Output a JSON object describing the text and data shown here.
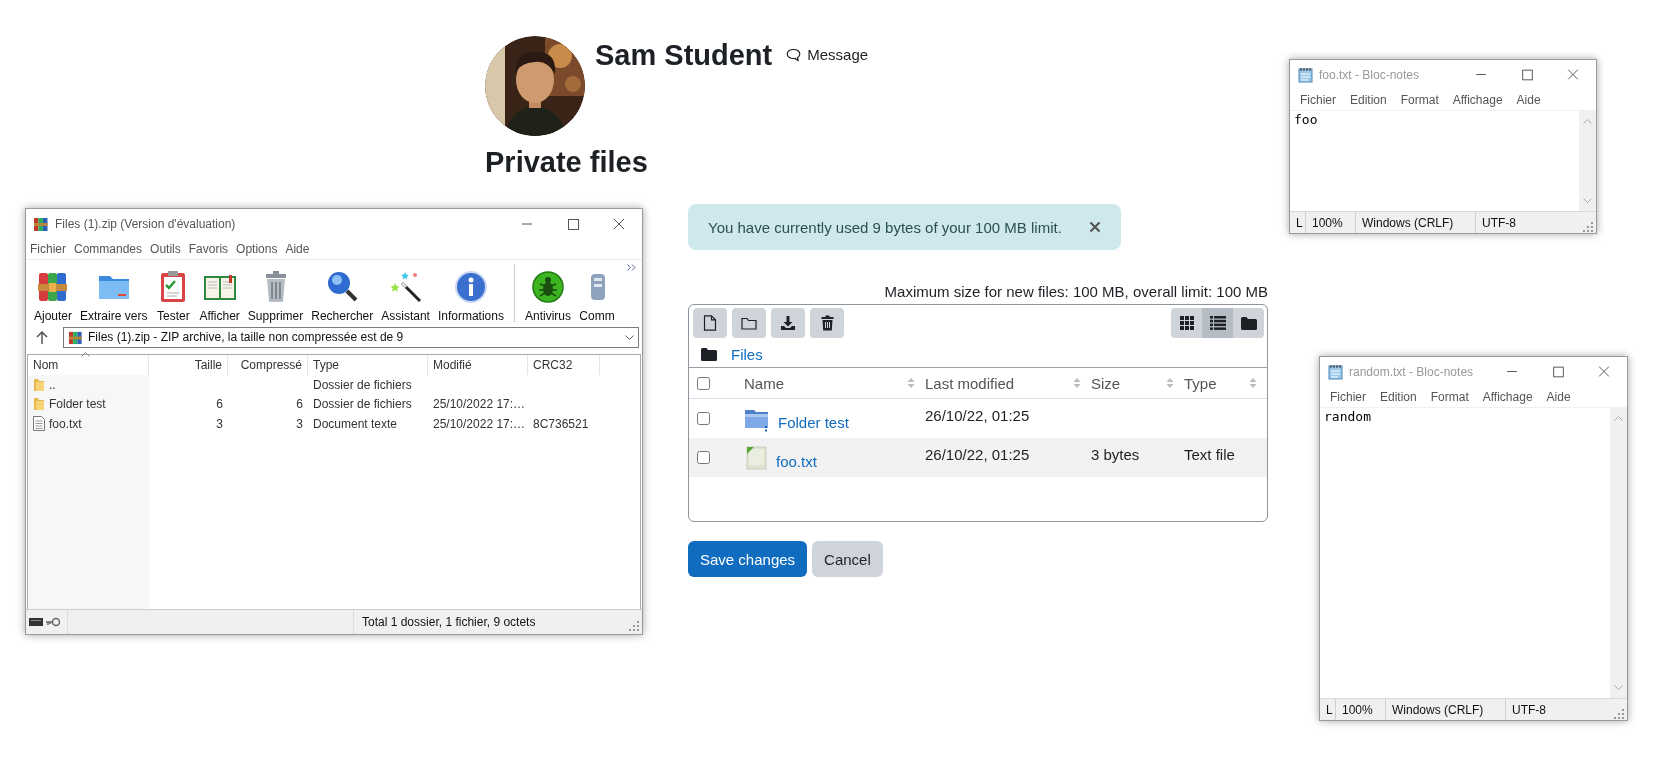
{
  "profile": {
    "name": "Sam Student",
    "message_link": "Message"
  },
  "heading": "Private files",
  "alert": {
    "text": "You have currently used 9 bytes of your 100 MB limit."
  },
  "file_manager": {
    "limits": "Maximum size for new files: 100 MB, overall limit: 100 MB",
    "view_modes": [
      {
        "kind": "icons",
        "selected": false
      },
      {
        "kind": "list",
        "selected": true
      },
      {
        "kind": "tree",
        "selected": false
      }
    ],
    "breadcrumb": "Files",
    "select_all": {
      "checked": false
    },
    "columns": [
      "Name",
      "Last modified",
      "Size",
      "Type"
    ],
    "rows": [
      {
        "kind": "folder",
        "name": "Folder test",
        "modified": "26/10/22, 01:25",
        "checked": false,
        "highlighted": false
      },
      {
        "kind": "file",
        "name": "foo.txt",
        "modified": "26/10/22, 01:25",
        "size": "3 bytes",
        "type": "Text file",
        "checked": false,
        "highlighted": true
      }
    ]
  },
  "buttons": [
    {
      "kind": "primary",
      "label": "Save changes"
    },
    {
      "kind": "secondary",
      "label": "Cancel"
    }
  ],
  "windows": [
    {
      "kind": "archiver",
      "title": "Files (1).zip (Version d'évaluation)",
      "menu": [
        "Fichier",
        "Commandes",
        "Outils",
        "Favoris",
        "Options",
        "Aide"
      ],
      "toolbar": [
        "Ajouter",
        "Extraire vers",
        "Tester",
        "Afficher",
        "Supprimer",
        "Rechercher",
        "Assistant",
        "Informations",
        "Antivirus",
        "Comm"
      ],
      "address": "Files (1).zip - ZIP archive, la taille non compressée est de 9",
      "columns": [
        "Nom",
        "Taille",
        "Compressé",
        "Type",
        "Modifié",
        "CRC32"
      ],
      "rows": [
        {
          "kind": "folder",
          "name": "..",
          "type": "Dossier de fichiers"
        },
        {
          "kind": "folder",
          "name": "Folder test",
          "size": "6",
          "packed": "6",
          "type": "Dossier de fichiers",
          "modified": "25/10/2022 17:…"
        },
        {
          "kind": "file",
          "name": "foo.txt",
          "size": "3",
          "packed": "3",
          "type": "Document texte",
          "modified": "25/10/2022 17:…",
          "crc": "8C736521"
        }
      ],
      "status": "Total 1 dossier, 1 fichier, 9 octets"
    },
    {
      "kind": "notepad",
      "title": "foo.txt - Bloc-notes",
      "menu": [
        "Fichier",
        "Edition",
        "Format",
        "Affichage",
        "Aide"
      ],
      "content": "foo",
      "status": [
        "L",
        "100%",
        "Windows (CRLF)",
        "UTF-8"
      ]
    },
    {
      "kind": "notepad",
      "title": "random.txt - Bloc-notes",
      "menu": [
        "Fichier",
        "Edition",
        "Format",
        "Affichage",
        "Aide"
      ],
      "content": "random",
      "status": [
        "L",
        "100%",
        "Windows (CRLF)",
        "UTF-8"
      ]
    }
  ]
}
